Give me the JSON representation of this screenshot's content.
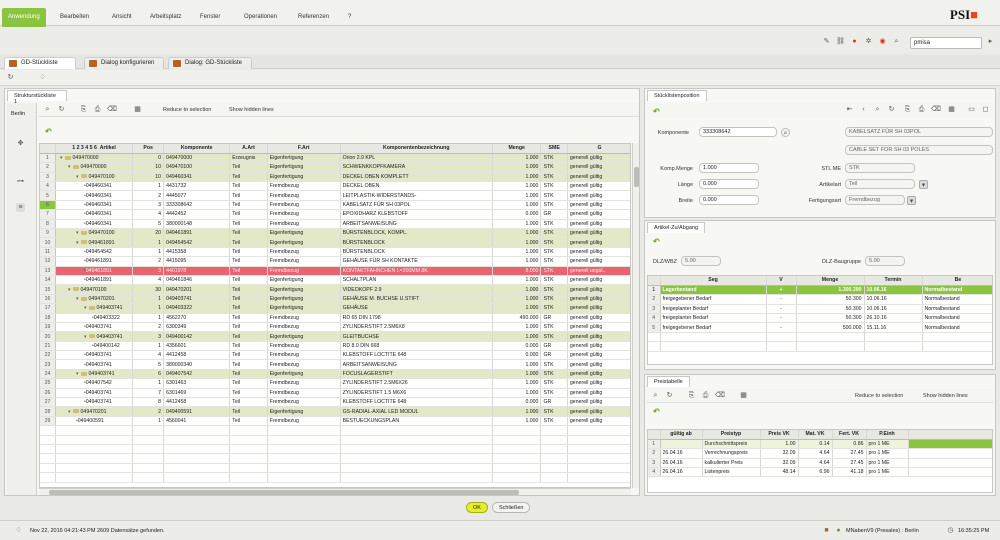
{
  "menu": {
    "items": [
      "Anwendung",
      "Bearbeiten",
      "Ansicht",
      "Arbeitsplatz",
      "Fenster",
      "Operationen",
      "Referenzen",
      "?"
    ],
    "logo": "PSI"
  },
  "toolbar": {
    "search_value": "pmisa"
  },
  "doc_tabs": [
    "GD-Stückliste",
    "Dialog konfigurieren",
    "Dialog: GD-Stückliste"
  ],
  "left_panel": {
    "tab": "Strukturstückliste 1",
    "side_label": "Berlin",
    "reduce_label": "Reduce to selection",
    "hidden_label": "Show hidden lines",
    "level_headers": [
      "1",
      "2",
      "3",
      "4",
      "5",
      "6"
    ],
    "columns": [
      "Artikel",
      "Pos",
      "Komponente",
      "A.Art",
      "F.Art",
      "Komponentenbezeichnung",
      "Menge",
      "SME",
      "G"
    ],
    "rows": [
      {
        "n": "1",
        "lvl": 0,
        "artikel": "049470000",
        "pos": "0",
        "komp": "049470000",
        "aart": "Erzeugnis",
        "fart": "Eigenfertigung",
        "bez": "Orion 2.9 KPL",
        "menge": "1.000",
        "sme": "STK",
        "g": "generell gültig",
        "style": "olive"
      },
      {
        "n": "2",
        "lvl": 1,
        "artikel": "049470000",
        "pos": "10",
        "komp": "049470100",
        "aart": "Teil",
        "fart": "Eigenfertigung",
        "bez": "SCHWENKKOPFKAMERA",
        "menge": "1.000",
        "sme": "STK",
        "g": "generell gültig",
        "style": "olive"
      },
      {
        "n": "3",
        "lvl": 2,
        "artikel": "049470100",
        "pos": "10",
        "komp": "049460341",
        "aart": "Teil",
        "fart": "Eigenfertigung",
        "bez": "DECKEL OBEN KOMPLETT",
        "menge": "1.000",
        "sme": "STK",
        "g": "generell gültig",
        "style": "olive"
      },
      {
        "n": "4",
        "lvl": 3,
        "artikel": "049460341",
        "pos": "1",
        "komp": "4431732",
        "aart": "Teil",
        "fart": "Fremdbezug",
        "bez": "DECKEL OBEN",
        "menge": "1.000",
        "sme": "STK",
        "g": "generell gültig",
        "style": ""
      },
      {
        "n": "5",
        "lvl": 3,
        "artikel": "049460341",
        "pos": "2",
        "komp": "4445077",
        "aart": "Teil",
        "fart": "Fremdbezug",
        "bez": "LEITPLASTIK-WIDERSTANDS-",
        "menge": "1.000",
        "sme": "STK",
        "g": "generell gültig",
        "style": ""
      },
      {
        "n": "6",
        "lvl": 3,
        "artikel": "049460341",
        "pos": "3",
        "komp": "333308642",
        "aart": "Teil",
        "fart": "Fremdbezug",
        "bez": "KABELSATZ FÜR SH 03POL",
        "menge": "1.000",
        "sme": "STK",
        "g": "generell gültig",
        "style": "sel"
      },
      {
        "n": "7",
        "lvl": 3,
        "artikel": "049460341",
        "pos": "4",
        "komp": "4442452",
        "aart": "Teil",
        "fart": "Fremdbezug",
        "bez": "EPOXIDHARZ KLEBSTOFF",
        "menge": "0.000",
        "sme": "GR",
        "g": "generell gültig",
        "style": ""
      },
      {
        "n": "8",
        "lvl": 3,
        "artikel": "049460341",
        "pos": "5",
        "komp": "380000148",
        "aart": "Teil",
        "fart": "Fremdbezug",
        "bez": "ARBEITSANWEISUNG",
        "menge": "1.000",
        "sme": "STK",
        "g": "generell gültig",
        "style": ""
      },
      {
        "n": "9",
        "lvl": 2,
        "artikel": "049470100",
        "pos": "20",
        "komp": "049461891",
        "aart": "Teil",
        "fart": "Eigenfertigung",
        "bez": "BÜRSTENBLOCK, KOMPL.",
        "menge": "1.000",
        "sme": "STK",
        "g": "generell gültig",
        "style": "olive"
      },
      {
        "n": "10",
        "lvl": 2,
        "artikel": "049461891",
        "pos": "1",
        "komp": "049454542",
        "aart": "Teil",
        "fart": "Eigenfertigung",
        "bez": "BÜRSTENBLOCK",
        "menge": "1.000",
        "sme": "STK",
        "g": "generell gültig",
        "style": "olive"
      },
      {
        "n": "11",
        "lvl": 3,
        "artikel": "049454542",
        "pos": "1",
        "komp": "4415358",
        "aart": "Teil",
        "fart": "Fremdbezug",
        "bez": "BÜRSTENBLOCK",
        "menge": "1.000",
        "sme": "STK",
        "g": "generell gültig",
        "style": ""
      },
      {
        "n": "12",
        "lvl": 3,
        "artikel": "049461891",
        "pos": "2",
        "komp": "4415095",
        "aart": "Teil",
        "fart": "Fremdbezug",
        "bez": "GEHÄUSE FÜR SH KONTAKTE",
        "menge": "1.000",
        "sme": "STK",
        "g": "generell gültig",
        "style": ""
      },
      {
        "n": "13",
        "lvl": 3,
        "artikel": "049461891",
        "pos": "3",
        "komp": "4401978",
        "aart": "Teil",
        "fart": "Fremdbezug",
        "bez": "KONTAKTFAHNCHEN L=200MM 8K",
        "menge": "8.000",
        "sme": "STK",
        "g": "generell ungül..",
        "style": "red"
      },
      {
        "n": "14",
        "lvl": 3,
        "artikel": "049461891",
        "pos": "4",
        "komp": "049461846",
        "aart": "Teil",
        "fart": "Eigenfertigung",
        "bez": "SCHALTPLAN",
        "menge": "1.000",
        "sme": "STK",
        "g": "generell gültig",
        "style": ""
      },
      {
        "n": "15",
        "lvl": 1,
        "artikel": "049470100",
        "pos": "30",
        "komp": "049470201",
        "aart": "Teil",
        "fart": "Eigenfertigung",
        "bez": "VIDEOKOPF 2.9",
        "menge": "1.000",
        "sme": "STK",
        "g": "generell gültig",
        "style": "olive"
      },
      {
        "n": "16",
        "lvl": 2,
        "artikel": "049470201",
        "pos": "1",
        "komp": "049403741",
        "aart": "Teil",
        "fart": "Eigenfertigung",
        "bez": "GEHÄUSE M. BUCHSE U.STIFT",
        "menge": "1.000",
        "sme": "STK",
        "g": "generell gültig",
        "style": "olive"
      },
      {
        "n": "17",
        "lvl": 3,
        "artikel": "049403741",
        "pos": "1",
        "komp": "049403322",
        "aart": "Teil",
        "fart": "Eigenfertigung",
        "bez": "GEHÄUSE",
        "menge": "1.000",
        "sme": "STK",
        "g": "generell gültig",
        "style": "olive"
      },
      {
        "n": "18",
        "lvl": 4,
        "artikel": "049403322",
        "pos": "1",
        "komp": "4562270",
        "aart": "Teil",
        "fart": "Fremdbezug",
        "bez": "RD 65 DIN 1798",
        "menge": "490.000",
        "sme": "GR",
        "g": "generell gültig",
        "style": ""
      },
      {
        "n": "19",
        "lvl": 3,
        "artikel": "049403741",
        "pos": "2",
        "komp": "6300349",
        "aart": "Teil",
        "fart": "Fremdbezug",
        "bez": "ZYLINDERSTIFT 2.5M6X8",
        "menge": "1.000",
        "sme": "STK",
        "g": "generell gültig",
        "style": ""
      },
      {
        "n": "20",
        "lvl": 3,
        "artikel": "049403741",
        "pos": "3",
        "komp": "049400142",
        "aart": "Teil",
        "fart": "Eigenfertigung",
        "bez": "GLEITBUCHSE",
        "menge": "1.000",
        "sme": "STK",
        "g": "generell gültig",
        "style": "olive"
      },
      {
        "n": "21",
        "lvl": 4,
        "artikel": "049400142",
        "pos": "1",
        "komp": "4356601",
        "aart": "Teil",
        "fart": "Fremdbezug",
        "bez": "RD 8.0 DIN 668",
        "menge": "0.000",
        "sme": "GR",
        "g": "generell gültig",
        "style": ""
      },
      {
        "n": "22",
        "lvl": 3,
        "artikel": "049403741",
        "pos": "4",
        "komp": "4412458",
        "aart": "Teil",
        "fart": "Fremdbezug",
        "bez": "KLEBSTOFF LOCTITE 648",
        "menge": "0.000",
        "sme": "GR",
        "g": "generell gültig",
        "style": ""
      },
      {
        "n": "23",
        "lvl": 3,
        "artikel": "049403741",
        "pos": "5",
        "komp": "380000340",
        "aart": "Teil",
        "fart": "Fremdbezug",
        "bez": "ARBEITSANWEISUNG",
        "menge": "1.000",
        "sme": "STK",
        "g": "generell gültig",
        "style": ""
      },
      {
        "n": "24",
        "lvl": 2,
        "artikel": "049403741",
        "pos": "6",
        "komp": "049407542",
        "aart": "Teil",
        "fart": "Eigenfertigung",
        "bez": "FOCUSLAGERSTIFT",
        "menge": "1.000",
        "sme": "STK",
        "g": "generell gültig",
        "style": "olive"
      },
      {
        "n": "25",
        "lvl": 3,
        "artikel": "049407542",
        "pos": "1",
        "komp": "6301463",
        "aart": "Teil",
        "fart": "Fremdbezug",
        "bez": "ZYLINDERSTIFT 2.5M6X26",
        "menge": "1.000",
        "sme": "STK",
        "g": "generell gültig",
        "style": ""
      },
      {
        "n": "26",
        "lvl": 3,
        "artikel": "049403741",
        "pos": "7",
        "komp": "6301469",
        "aart": "Teil",
        "fart": "Fremdbezug",
        "bez": "ZYLINDERSTIFT 1.5 M6X6",
        "menge": "1.000",
        "sme": "STK",
        "g": "generell gültig",
        "style": ""
      },
      {
        "n": "27",
        "lvl": 3,
        "artikel": "049403741",
        "pos": "8",
        "komp": "4412458",
        "aart": "Teil",
        "fart": "Fremdbezug",
        "bez": "KLEBSTOFF LOCTITE 648",
        "menge": "0.000",
        "sme": "GR",
        "g": "generell gültig",
        "style": ""
      },
      {
        "n": "28",
        "lvl": 1,
        "artikel": "049470201",
        "pos": "2",
        "komp": "049400591",
        "aart": "Teil",
        "fart": "Eigenfertigung",
        "bez": "GS-RADIAL-AXIAL LED MODUL",
        "menge": "1.000",
        "sme": "STK",
        "g": "generell gültig",
        "style": "olive"
      },
      {
        "n": "29",
        "lvl": 2,
        "artikel": "049400591",
        "pos": "1",
        "komp": "4560041",
        "aart": "Teil",
        "fart": "Fremdbezug",
        "bez": "BESTUECKUNGSPLAN",
        "menge": "1.000",
        "sme": "STK",
        "g": "generell gültig",
        "style": ""
      }
    ]
  },
  "position_panel": {
    "tab": "Stücklistenposition",
    "komponente_label": "Komponente",
    "komponente_value": "333308642",
    "desc1": "KABELSATZ FÜR SH 03POL",
    "desc2": "CABLE SET FOR SH 03 POLES",
    "komp_menge_label": "Komp.Menge",
    "komp_menge_value": "1.000",
    "stl_me_label": "STL ME",
    "stl_me_value": "STK",
    "laenge_label": "Länge",
    "laenge_value": "0.000",
    "artikelart_label": "Artikelart",
    "artikelart_value": "Teil",
    "breite_label": "Breite",
    "breite_value": "0.000",
    "fertigungsart_label": "Fertigungsart",
    "fertigungsart_value": "Fremdbezug"
  },
  "zugang_panel": {
    "tab": "Artikel-Zu/Abgang",
    "dlz_wbz_label": "DLZ/WBZ",
    "dlz_wbz_value": "5.00",
    "dlz_bg_label": "DLZ-Baugruppe",
    "dlz_bg_value": "5.00",
    "columns": [
      "Seg",
      "V",
      "Menge",
      "Termin",
      "Be"
    ],
    "rows": [
      {
        "n": "1",
        "seg": "Lagerbestand",
        "v": "+",
        "menge": "1.300.300",
        "termin": "10.06.16",
        "be": "Normalbestand",
        "style": "green"
      },
      {
        "n": "2",
        "seg": "freigegebener Bedarf",
        "v": "-",
        "menge": "50.300",
        "termin": "10.06.16",
        "be": "Normalbestand",
        "style": ""
      },
      {
        "n": "3",
        "seg": "freigeplanter Bedarf",
        "v": "-",
        "menge": "50.300",
        "termin": "10.06.16",
        "be": "Normalbestand",
        "style": ""
      },
      {
        "n": "4",
        "seg": "freigeplanter Bedarf",
        "v": "-",
        "menge": "50.300",
        "termin": "26.10.16",
        "be": "Normalbestand",
        "style": ""
      },
      {
        "n": "5",
        "seg": "freigegebener Bedarf",
        "v": "-",
        "menge": "500.000",
        "termin": "15.11.16",
        "be": "Normalbestand",
        "style": ""
      }
    ]
  },
  "preis_panel": {
    "tab": "Preistabelle",
    "reduce_label": "Reduce to selection",
    "hidden_label": "Show hidden lines",
    "columns": [
      "gültig ab",
      "Preistyp",
      "Preis VK",
      "Mat. VK",
      "Fert. VK",
      "P.Einh"
    ],
    "rows": [
      {
        "n": "1",
        "gab": "",
        "typ": "Durchschnittspreis",
        "pvk": "1.00",
        "mvk": "0.14",
        "fvk": "0.86",
        "pe": "pro 1 ME",
        "style": "sel"
      },
      {
        "n": "2",
        "gab": "26.04.16",
        "typ": "Verrechnungspreis",
        "pvk": "32.09",
        "mvk": "4.64",
        "fvk": "27.45",
        "pe": "pro 1 ME",
        "style": ""
      },
      {
        "n": "3",
        "gab": "26.04.16",
        "typ": "kalkulierter Preis",
        "pvk": "32.09",
        "mvk": "4.64",
        "fvk": "27.45",
        "pe": "pro 1 ME",
        "style": ""
      },
      {
        "n": "4",
        "gab": "26.04.16",
        "typ": "Listenpreis",
        "pvk": "48.14",
        "mvk": "6.96",
        "fvk": "41.18",
        "pe": "pro 1 ME",
        "style": ""
      }
    ]
  },
  "buttons": {
    "ok": "OK",
    "close": "Schließen"
  },
  "status": {
    "left": "Nov 22, 2016 04:21:43 PM  2609 Datensätze gefunden.",
    "right_user": "MNabenV9 (Presales) : Berlin",
    "time": "16:35:25 PM"
  },
  "colors": {
    "accent": "#8bc43f",
    "error_row": "#e8646f",
    "olive_row": "#e3e8c8",
    "ok_button": "#e7ee2b"
  }
}
